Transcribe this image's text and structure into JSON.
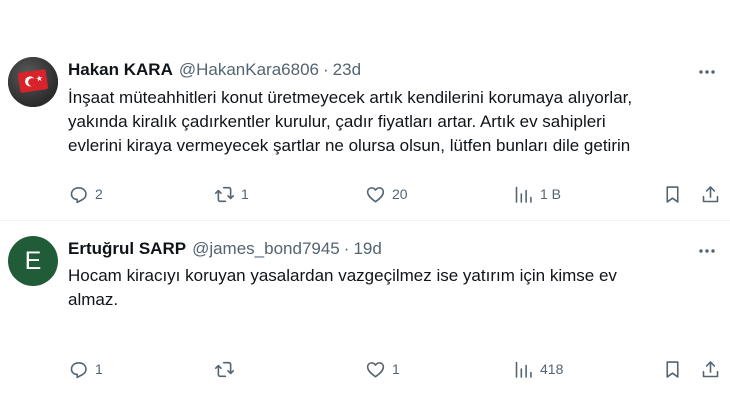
{
  "tweets": [
    {
      "author": {
        "name": "Hakan KARA",
        "handle": "@HakanKara6806",
        "avatar": "turkish-flag"
      },
      "separator": "·",
      "time": "23d",
      "text_lines": [
        "İnşaat müteahhitleri konut üretmeyecek artık kendilerini korumaya alıyorlar,",
        "yakında kiralık çadırkentler kurulur, çadır fiyatları artar. Artık ev sahipleri",
        "evlerini kiraya vermeyecek şartlar ne olursa olsun, lütfen bunları dile getirin"
      ],
      "stats": {
        "replies": "2",
        "reposts": "1",
        "likes": "20",
        "views": "1 B"
      }
    },
    {
      "author": {
        "name": "Ertuğrul SARP",
        "handle": "@james_bond7945",
        "avatar_letter": "E"
      },
      "separator": "·",
      "time": "19d",
      "text_lines": [
        "Hocam kiracıyı koruyan yasalardan vazgeçilmez ise yatırım için kimse ev",
        "almaz."
      ],
      "stats": {
        "replies": "1",
        "reposts": "",
        "likes": "1",
        "views": "418"
      }
    }
  ],
  "icons": {
    "more": "more-icon",
    "reply": "reply-icon",
    "repost": "repost-icon",
    "like": "like-icon",
    "views": "views-icon",
    "bookmark": "bookmark-icon",
    "share": "share-icon"
  },
  "colors": {
    "text": "#0f1419",
    "secondary": "#536471",
    "divider": "#eff3f4",
    "avatar_bg": "#1f5c37",
    "flag_red": "#d8232a"
  }
}
